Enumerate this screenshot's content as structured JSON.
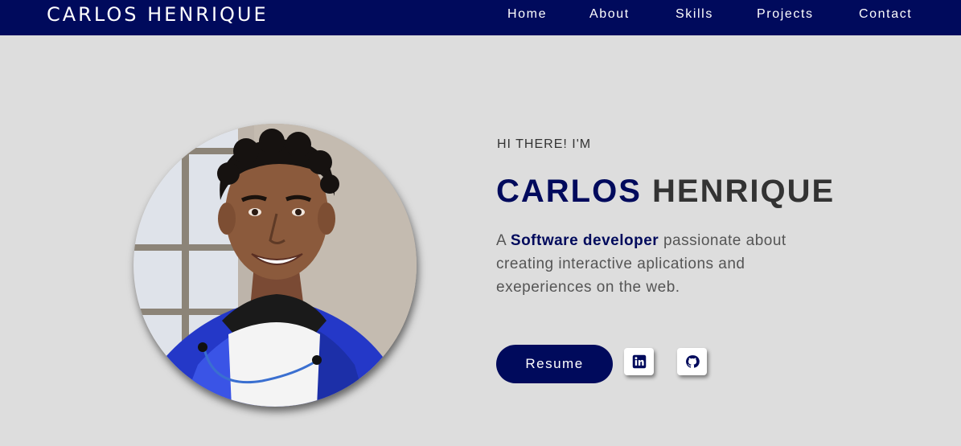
{
  "nav": {
    "brand": "CARLOS HENRIQUE",
    "links": [
      "Home",
      "About",
      "Skills",
      "Projects",
      "Contact"
    ]
  },
  "hero": {
    "greeting": "HI THERE! I'M",
    "name_first": "CARLOS",
    "name_last": "HENRIQUE",
    "desc_prefix": "A ",
    "desc_highlight": "Software developer",
    "desc_rest": " passionate about creating interactive aplications and exeperiences on the web.",
    "resume_label": "Resume",
    "social": [
      {
        "icon": "linkedin-icon"
      },
      {
        "icon": "github-icon"
      }
    ]
  },
  "colors": {
    "navy": "#000a5c",
    "background": "#dddddd",
    "text_dark": "#333333",
    "text_muted": "#555555"
  }
}
